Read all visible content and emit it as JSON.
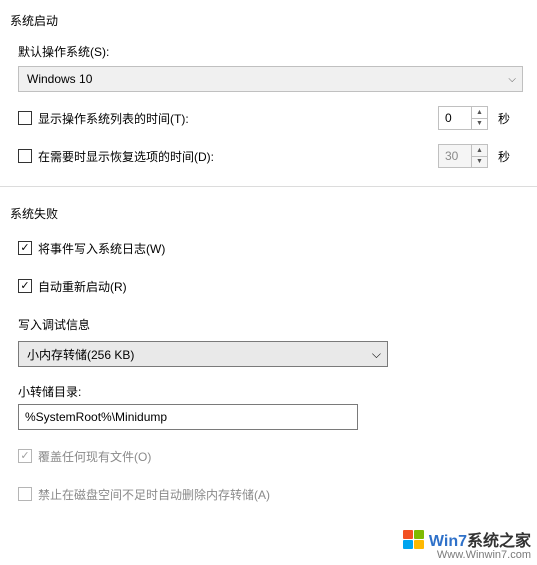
{
  "startup": {
    "title": "系统启动",
    "default_os_label": "默认操作系统(S):",
    "default_os_value": "Windows 10",
    "show_os_list": {
      "checked": false,
      "label": "显示操作系统列表的时间(T):",
      "value": "0",
      "unit": "秒"
    },
    "show_recovery": {
      "checked": false,
      "label": "在需要时显示恢复选项的时间(D):",
      "value": "30",
      "unit": "秒"
    }
  },
  "failure": {
    "title": "系统失败",
    "write_log": {
      "checked": true,
      "label": "将事件写入系统日志(W)"
    },
    "auto_restart": {
      "checked": true,
      "label": "自动重新启动(R)"
    },
    "debug_heading": "写入调试信息",
    "dump_type": "小内存转储(256 KB)",
    "dump_dir_label": "小转储目录:",
    "dump_dir_value": "%SystemRoot%\\Minidump",
    "overwrite": {
      "checked": true,
      "disabled": true,
      "label": "覆盖任何现有文件(O)"
    },
    "disable_auto_delete": {
      "checked": false,
      "disabled": true,
      "label": "禁止在磁盘空间不足时自动删除内存转储(A)"
    }
  },
  "watermark": {
    "brand_prefix": "Win7",
    "brand_suffix": "系统之家",
    "url": "Www.Winwin7.com"
  }
}
